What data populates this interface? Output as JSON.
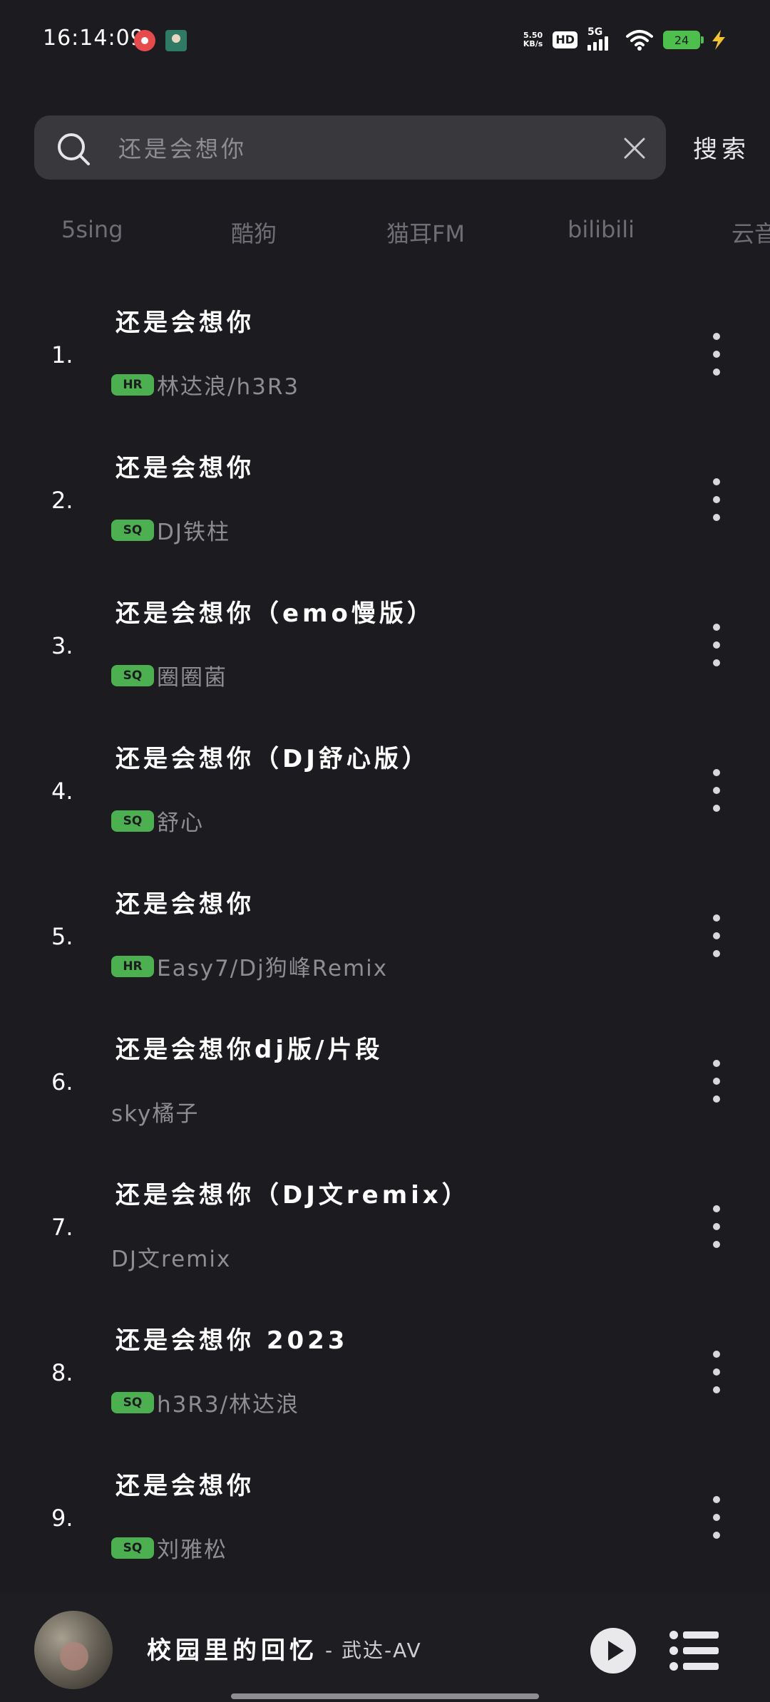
{
  "status_bar": {
    "time": "16:14:09",
    "net_speed_value": "5.50",
    "net_speed_unit": "KB/s",
    "hd_label": "HD",
    "network_label": "5G",
    "battery": "24",
    "icons": [
      "netease-music-icon",
      "avatar-app-icon",
      "signal-icon",
      "wifi-icon",
      "battery-icon",
      "charging-bolt-icon"
    ]
  },
  "search": {
    "value": "还是会想你",
    "button_label": "搜索"
  },
  "sources": [
    "5sing",
    "酷狗",
    "猫耳FM",
    "bilibili",
    "云音"
  ],
  "results": [
    {
      "index": "1.",
      "title": "还是会想你",
      "badge": "HR",
      "artist": "林达浪/h3R3"
    },
    {
      "index": "2.",
      "title": "还是会想你",
      "badge": "SQ",
      "artist": "DJ铁柱"
    },
    {
      "index": "3.",
      "title": "还是会想你（emo慢版）",
      "badge": "SQ",
      "artist": "圈圈菌"
    },
    {
      "index": "4.",
      "title": "还是会想你（DJ舒心版）",
      "badge": "SQ",
      "artist": "舒心"
    },
    {
      "index": "5.",
      "title": "还是会想你",
      "badge": "HR",
      "artist": "Easy7/Dj狗峰Remix"
    },
    {
      "index": "6.",
      "title": "还是会想你dj版/片段",
      "badge": "",
      "artist": "sky橘子"
    },
    {
      "index": "7.",
      "title": "还是会想你（DJ文remix）",
      "badge": "",
      "artist": "DJ文remix"
    },
    {
      "index": "8.",
      "title": "还是会想你 2023",
      "badge": "SQ",
      "artist": "h3R3/林达浪"
    },
    {
      "index": "9.",
      "title": "还是会想你",
      "badge": "SQ",
      "artist": "刘雅松"
    }
  ],
  "player": {
    "title": "校园里的回忆",
    "artist": "- 武达-AV"
  },
  "colors": {
    "background": "#1b1b20",
    "search_bg": "#38383d",
    "badge_green": "#4caf50",
    "muted_text": "#8d8d92"
  }
}
